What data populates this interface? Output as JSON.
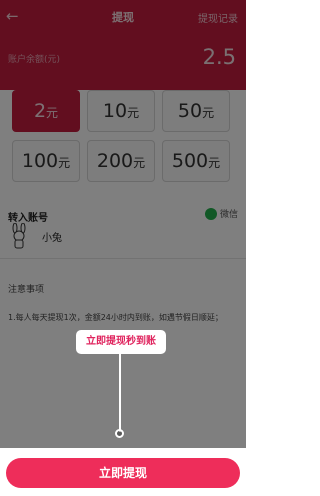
{
  "header": {
    "back_icon": "back-arrow-icon",
    "title": "提现",
    "record_label": "提现记录"
  },
  "balance": {
    "label": "账户余额(元)",
    "value": "2.5"
  },
  "amounts": [
    {
      "value": "2",
      "unit": "元",
      "selected": true
    },
    {
      "value": "10",
      "unit": "元",
      "selected": false
    },
    {
      "value": "50",
      "unit": "元",
      "selected": false
    },
    {
      "value": "100",
      "unit": "元",
      "selected": false
    },
    {
      "value": "200",
      "unit": "元",
      "selected": false
    },
    {
      "value": "500",
      "unit": "元",
      "selected": false
    }
  ],
  "transfer": {
    "title": "转入账号",
    "method_label": "微信",
    "method_icon": "wechat-icon",
    "account_name": "小兔"
  },
  "notes": {
    "title": "注意事项",
    "line1": "1.每人每天提现1次，金额24小时内到账，如遇节假日顺延；"
  },
  "tooltip": {
    "text": "立即提现秒到账"
  },
  "cta": {
    "label": "立即提现"
  },
  "colors": {
    "header_bg": "#c41d3f",
    "cta_bg": "#ee2d5a",
    "tooltip_text": "#e0245e"
  }
}
